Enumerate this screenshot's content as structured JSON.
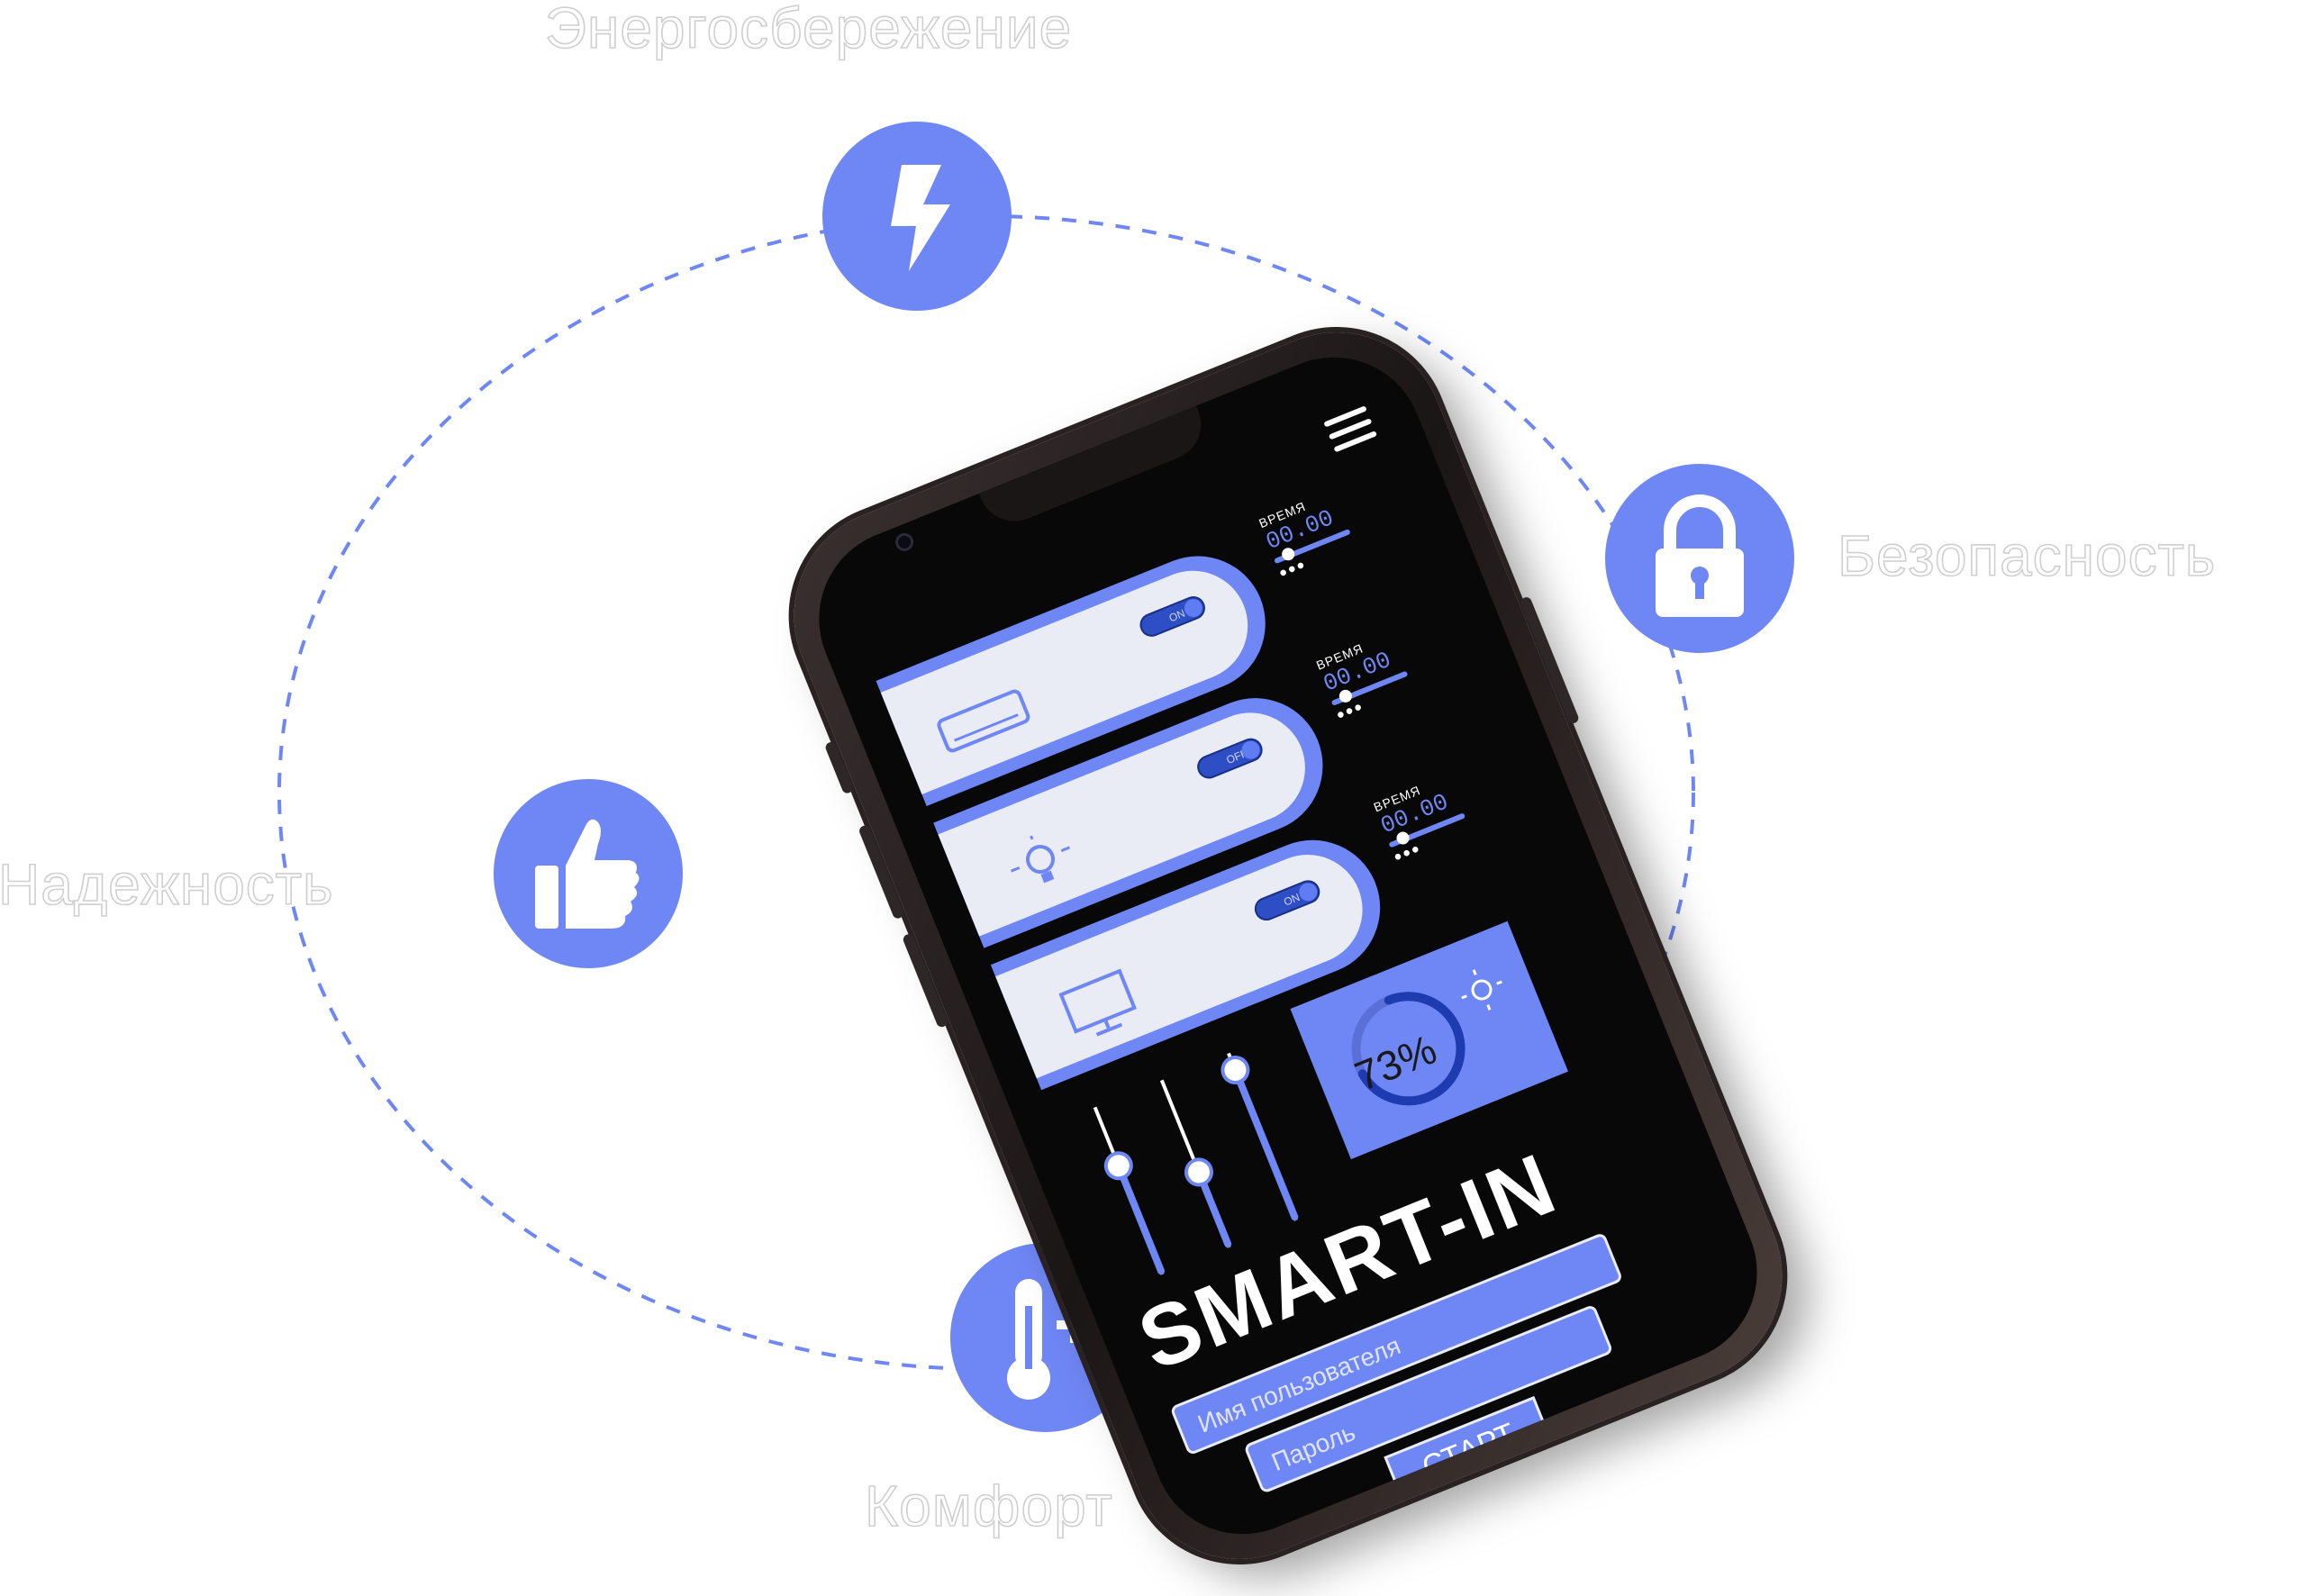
{
  "features": [
    {
      "label": "Энергосбережение",
      "icon": "lightning-icon"
    },
    {
      "label": "Безопасность",
      "icon": "padlock-icon"
    },
    {
      "label": "Надежность",
      "icon": "thumbs-up-icon"
    },
    {
      "label": "Комфорт",
      "icon": "thermometer-plus-icon"
    }
  ],
  "colors": {
    "accent": "#6f87f5",
    "screen": "#080808",
    "card": "#e9ebf5"
  },
  "app": {
    "brand": "SMART-IN",
    "devices": [
      {
        "icon": "air-conditioner-icon",
        "toggle": "ON",
        "timer_label": "ВРЕМЯ",
        "timer_value": "00.00"
      },
      {
        "icon": "light-bulb-icon",
        "toggle": "OFF",
        "timer_label": "ВРЕМЯ",
        "timer_value": "00.00"
      },
      {
        "icon": "monitor-icon",
        "toggle": "ON",
        "timer_label": "ВРЕМЯ",
        "timer_value": "00.00"
      }
    ],
    "sliders": [
      0.65,
      0.45,
      0.9
    ],
    "gauge": {
      "value_text": "73%",
      "fraction": 0.73
    },
    "login": {
      "username_placeholder": "Имя пользователя",
      "password_placeholder": "Пароль",
      "start_label": "СТАРТ"
    }
  }
}
